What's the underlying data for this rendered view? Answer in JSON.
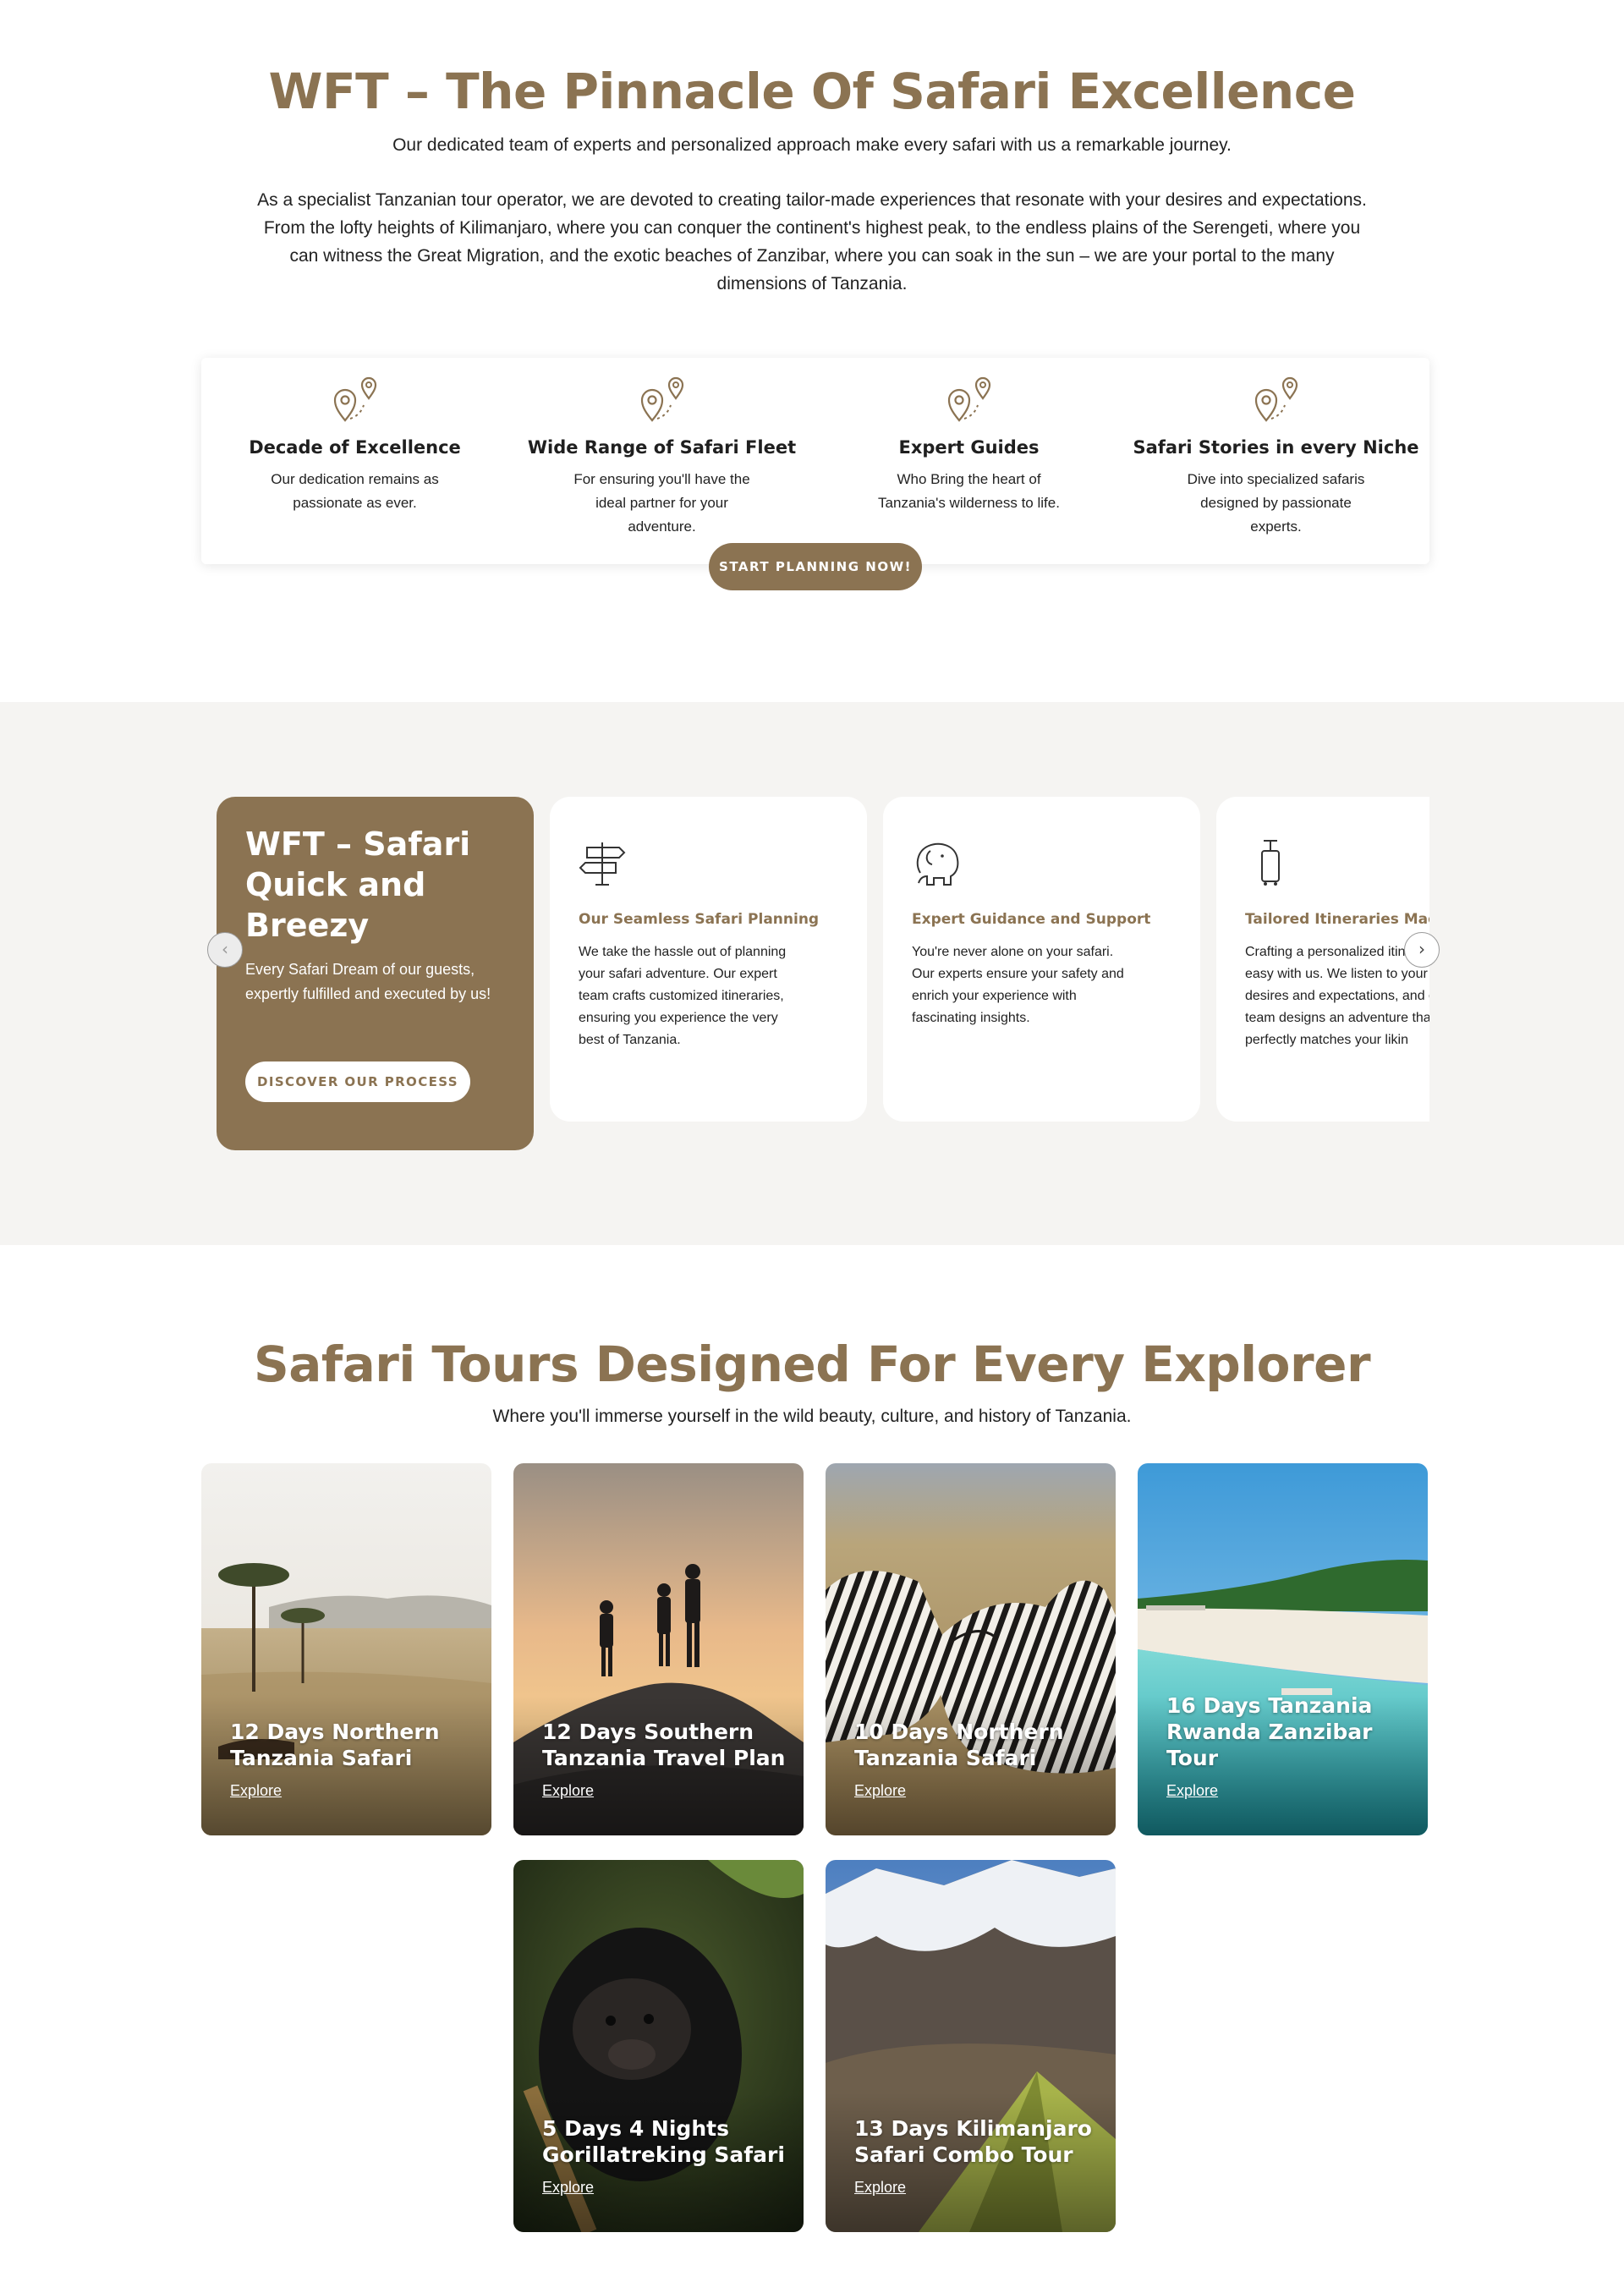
{
  "hero": {
    "title": "WFT – The Pinnacle Of Safari Excellence",
    "tagline": "Our dedicated team of experts and personalized approach make every safari with us a remarkable journey.",
    "intro": "As a specialist Tanzanian tour operator, we are devoted to creating tailor-made experiences that resonate with your desires and expectations. From the lofty heights of Kilimanjaro, where you can conquer the continent's highest peak, to the endless plains of the Serengeti, where you can witness the Great Migration, and the exotic beaches of Zanzibar, where you can soak in the sun – we are your portal to the many dimensions of Tanzania."
  },
  "features": [
    {
      "icon": "map-pins-icon",
      "title": "Decade of Excellence",
      "text": "Our dedication remains as passionate as ever."
    },
    {
      "icon": "map-pins-icon",
      "title": "Wide Range of Safari Fleet",
      "text": "For ensuring you'll have the ideal partner for your adventure."
    },
    {
      "icon": "map-pins-icon",
      "title": "Expert Guides",
      "text": "Who Bring the heart of Tanzania's wilderness to life."
    },
    {
      "icon": "map-pins-icon",
      "title": "Safari Stories in every Niche",
      "text": "Dive into specialized safaris designed by passionate experts."
    }
  ],
  "cta": {
    "label": "START PLANNING NOW!"
  },
  "process": {
    "intro_title": "WFT – Safari Quick and Breezy",
    "intro_text": "Every Safari Dream of our guests, expertly fulfilled and executed by us!",
    "discover_label": "DISCOVER OUR PROCESS",
    "prev_arrow": "‹",
    "next_arrow": "›",
    "steps": [
      {
        "icon": "signpost-icon",
        "title": "Our Seamless Safari Planning",
        "text": "We take the hassle out of planning your safari adventure. Our expert team crafts customized itineraries, ensuring you experience the very best of Tanzania."
      },
      {
        "icon": "elephant-icon",
        "title": "Expert Guidance and Support",
        "text": "You're never alone on your safari. Our experts ensure your safety and enrich your experience with fascinating insights."
      },
      {
        "icon": "luggage-icon",
        "title": "Tailored Itineraries Mad",
        "text": "Crafting a personalized itinerary is easy with us. We listen to your desires and expectations, and our team designs an adventure that perfectly matches your likin"
      }
    ]
  },
  "tours": {
    "title": "Safari Tours Designed For Every Explorer",
    "subtitle": "Where you'll immerse yourself in the wild beauty, culture, and history of Tanzania.",
    "explore_label": "Explore",
    "items": [
      {
        "title": "12 Days Northern Tanzania Safari",
        "scene": "savanna"
      },
      {
        "title": "12 Days Southern Tanzania Travel Plan",
        "scene": "sunset"
      },
      {
        "title": "10 Days Northern Tanzania Safari",
        "scene": "zebra"
      },
      {
        "title": "16 Days Tanzania Rwanda Zanzibar Tour",
        "scene": "beach"
      },
      {
        "title": "5 Days 4 Nights Gorillatreking Safari",
        "scene": "gorilla"
      },
      {
        "title": "13 Days Kilimanjaro Safari Combo Tour",
        "scene": "mountain"
      }
    ]
  },
  "colors": {
    "brand": "#8b7352",
    "band": "#f5f4f2"
  }
}
